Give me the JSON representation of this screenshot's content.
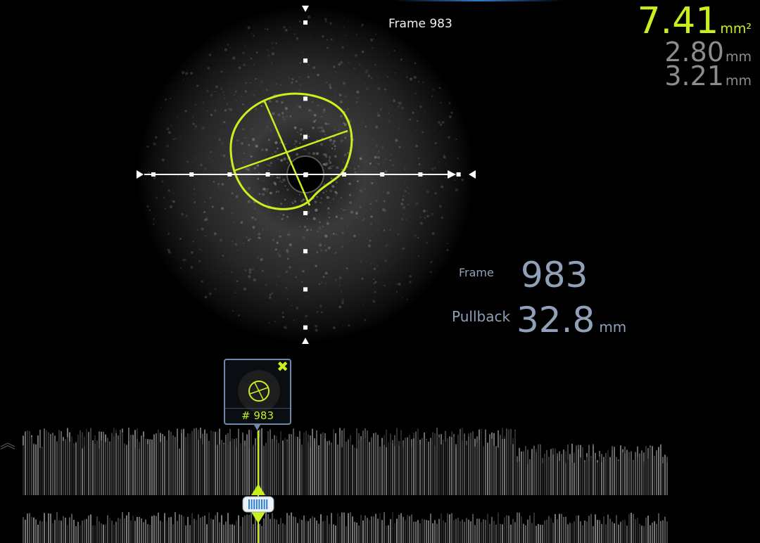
{
  "frame_header": "Frame 983",
  "measurements": {
    "area": "7.41",
    "area_unit": "mm²",
    "diameter_min": "2.80",
    "diameter_max": "3.21",
    "length_unit": "mm",
    "area_color": "#c8f01e",
    "diameter_color": "#8c8c8c"
  },
  "info": {
    "frame_label": "Frame",
    "frame_value": "983",
    "pullback_label": "Pullback",
    "pullback_value": "32.8",
    "pullback_unit": "mm",
    "color": "#8fa0b8"
  },
  "bookmark": {
    "label": "# 983",
    "close_icon": "close-icon"
  },
  "colors": {
    "contour": "#c8f01e",
    "accent": "#2a7fd0"
  }
}
